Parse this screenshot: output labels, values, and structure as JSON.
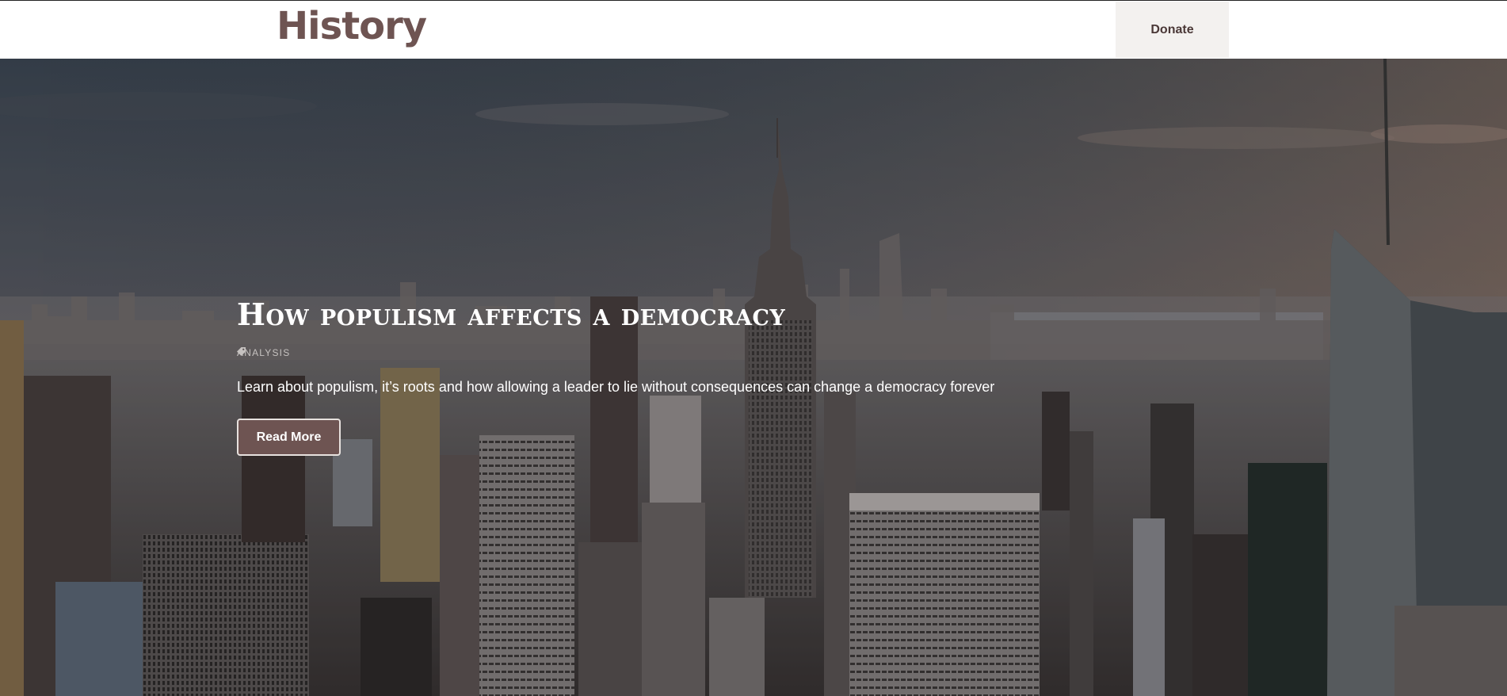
{
  "site": {
    "title": "History"
  },
  "header": {
    "donate_label": "Donate"
  },
  "hero": {
    "title": "How populism affects a democracy",
    "category": "ANALYSIS",
    "category_icon": "tag-icon",
    "excerpt": "Learn about populism, it’s roots and how allowing a leader to lie without consequences can change a democracy forever",
    "read_more_label": "Read More"
  },
  "colors": {
    "brand": "#6e5452",
    "donate_bg": "#f3f1ef",
    "header_bg": "#ffffff"
  }
}
